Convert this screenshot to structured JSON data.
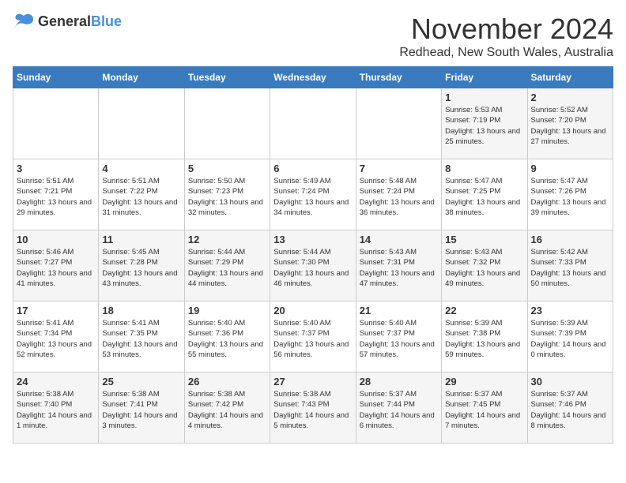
{
  "header": {
    "logo_general": "General",
    "logo_blue": "Blue",
    "month_title": "November 2024",
    "location": "Redhead, New South Wales, Australia"
  },
  "days_of_week": [
    "Sunday",
    "Monday",
    "Tuesday",
    "Wednesday",
    "Thursday",
    "Friday",
    "Saturday"
  ],
  "weeks": [
    [
      {
        "day": "",
        "info": ""
      },
      {
        "day": "",
        "info": ""
      },
      {
        "day": "",
        "info": ""
      },
      {
        "day": "",
        "info": ""
      },
      {
        "day": "",
        "info": ""
      },
      {
        "day": "1",
        "info": "Sunrise: 5:53 AM\nSunset: 7:19 PM\nDaylight: 13 hours and 25 minutes."
      },
      {
        "day": "2",
        "info": "Sunrise: 5:52 AM\nSunset: 7:20 PM\nDaylight: 13 hours and 27 minutes."
      }
    ],
    [
      {
        "day": "3",
        "info": "Sunrise: 5:51 AM\nSunset: 7:21 PM\nDaylight: 13 hours and 29 minutes."
      },
      {
        "day": "4",
        "info": "Sunrise: 5:51 AM\nSunset: 7:22 PM\nDaylight: 13 hours and 31 minutes."
      },
      {
        "day": "5",
        "info": "Sunrise: 5:50 AM\nSunset: 7:23 PM\nDaylight: 13 hours and 32 minutes."
      },
      {
        "day": "6",
        "info": "Sunrise: 5:49 AM\nSunset: 7:24 PM\nDaylight: 13 hours and 34 minutes."
      },
      {
        "day": "7",
        "info": "Sunrise: 5:48 AM\nSunset: 7:24 PM\nDaylight: 13 hours and 36 minutes."
      },
      {
        "day": "8",
        "info": "Sunrise: 5:47 AM\nSunset: 7:25 PM\nDaylight: 13 hours and 38 minutes."
      },
      {
        "day": "9",
        "info": "Sunrise: 5:47 AM\nSunset: 7:26 PM\nDaylight: 13 hours and 39 minutes."
      }
    ],
    [
      {
        "day": "10",
        "info": "Sunrise: 5:46 AM\nSunset: 7:27 PM\nDaylight: 13 hours and 41 minutes."
      },
      {
        "day": "11",
        "info": "Sunrise: 5:45 AM\nSunset: 7:28 PM\nDaylight: 13 hours and 43 minutes."
      },
      {
        "day": "12",
        "info": "Sunrise: 5:44 AM\nSunset: 7:29 PM\nDaylight: 13 hours and 44 minutes."
      },
      {
        "day": "13",
        "info": "Sunrise: 5:44 AM\nSunset: 7:30 PM\nDaylight: 13 hours and 46 minutes."
      },
      {
        "day": "14",
        "info": "Sunrise: 5:43 AM\nSunset: 7:31 PM\nDaylight: 13 hours and 47 minutes."
      },
      {
        "day": "15",
        "info": "Sunrise: 5:43 AM\nSunset: 7:32 PM\nDaylight: 13 hours and 49 minutes."
      },
      {
        "day": "16",
        "info": "Sunrise: 5:42 AM\nSunset: 7:33 PM\nDaylight: 13 hours and 50 minutes."
      }
    ],
    [
      {
        "day": "17",
        "info": "Sunrise: 5:41 AM\nSunset: 7:34 PM\nDaylight: 13 hours and 52 minutes."
      },
      {
        "day": "18",
        "info": "Sunrise: 5:41 AM\nSunset: 7:35 PM\nDaylight: 13 hours and 53 minutes."
      },
      {
        "day": "19",
        "info": "Sunrise: 5:40 AM\nSunset: 7:36 PM\nDaylight: 13 hours and 55 minutes."
      },
      {
        "day": "20",
        "info": "Sunrise: 5:40 AM\nSunset: 7:37 PM\nDaylight: 13 hours and 56 minutes."
      },
      {
        "day": "21",
        "info": "Sunrise: 5:40 AM\nSunset: 7:37 PM\nDaylight: 13 hours and 57 minutes."
      },
      {
        "day": "22",
        "info": "Sunrise: 5:39 AM\nSunset: 7:38 PM\nDaylight: 13 hours and 59 minutes."
      },
      {
        "day": "23",
        "info": "Sunrise: 5:39 AM\nSunset: 7:39 PM\nDaylight: 14 hours and 0 minutes."
      }
    ],
    [
      {
        "day": "24",
        "info": "Sunrise: 5:38 AM\nSunset: 7:40 PM\nDaylight: 14 hours and 1 minute."
      },
      {
        "day": "25",
        "info": "Sunrise: 5:38 AM\nSunset: 7:41 PM\nDaylight: 14 hours and 3 minutes."
      },
      {
        "day": "26",
        "info": "Sunrise: 5:38 AM\nSunset: 7:42 PM\nDaylight: 14 hours and 4 minutes."
      },
      {
        "day": "27",
        "info": "Sunrise: 5:38 AM\nSunset: 7:43 PM\nDaylight: 14 hours and 5 minutes."
      },
      {
        "day": "28",
        "info": "Sunrise: 5:37 AM\nSunset: 7:44 PM\nDaylight: 14 hours and 6 minutes."
      },
      {
        "day": "29",
        "info": "Sunrise: 5:37 AM\nSunset: 7:45 PM\nDaylight: 14 hours and 7 minutes."
      },
      {
        "day": "30",
        "info": "Sunrise: 5:37 AM\nSunset: 7:46 PM\nDaylight: 14 hours and 8 minutes."
      }
    ]
  ]
}
